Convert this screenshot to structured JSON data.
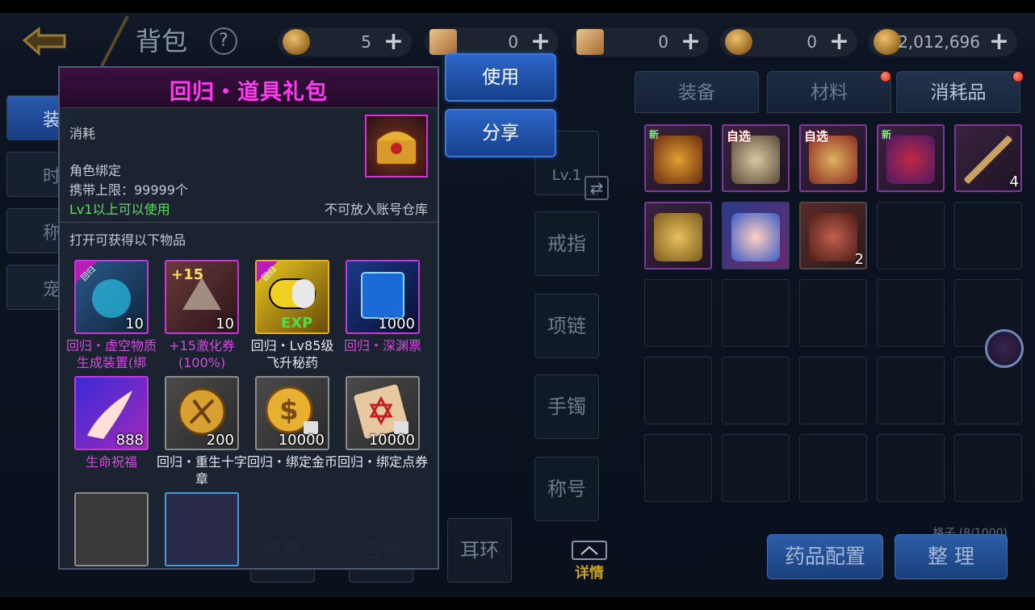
{
  "header": {
    "title": "背包",
    "help_label": "?",
    "currencies": [
      {
        "icon": "coin-icon",
        "value": "5"
      },
      {
        "icon": "scroll-icon",
        "value": "0"
      },
      {
        "icon": "locked-scroll-icon",
        "value": "0"
      },
      {
        "icon": "coin-icon",
        "value": "0"
      },
      {
        "icon": "bound-gold-icon",
        "value": "2,012,696"
      }
    ],
    "plus_label": "+"
  },
  "left_tabs": [
    "装",
    "时",
    "称",
    "宠"
  ],
  "middle": {
    "level_label": "Lv.1",
    "slots": [
      "戒指",
      "项链",
      "手镯",
      "称号"
    ],
    "bottom_slots": [
      "肩章",
      "宝物",
      "耳环"
    ],
    "detail_label": "详情"
  },
  "right": {
    "tabs": [
      "装备",
      "材料",
      "消耗品"
    ],
    "grid_count": "格子 (8/1000)",
    "items": [
      {
        "tag": "新",
        "count": ""
      },
      {
        "tag": "自选",
        "count": ""
      },
      {
        "tag": "自选",
        "count": ""
      },
      {
        "tag": "新",
        "count": ""
      },
      {
        "tag": "",
        "count": "4"
      },
      {
        "tag": "",
        "count": ""
      },
      {
        "tag": "",
        "count": ""
      },
      {
        "tag": "",
        "count": "2"
      }
    ],
    "potion_button": "药品配置",
    "sort_button": "整 理"
  },
  "popup": {
    "title": "回归・道具礼包",
    "category": "消耗",
    "bind": "角色绑定",
    "carry_limit": "携带上限：99999个",
    "level_req": "Lv1以上可以使用",
    "warehouse_note": "不可放入账号仓库",
    "contents_header": "打开可获得以下物品",
    "ribbon_text": "回归",
    "items": [
      {
        "name": "回归・虚空物质生成装置(绑",
        "count": "10",
        "frame": "purple",
        "name_color": "purple"
      },
      {
        "name": "+15激化券(100%)",
        "count": "10",
        "frame": "purple",
        "name_color": "purple"
      },
      {
        "name": "回归・Lv85级飞升秘药",
        "count": "",
        "frame": "gold",
        "name_color": "white"
      },
      {
        "name": "回归・深渊票",
        "count": "1000",
        "frame": "purple",
        "name_color": "purple"
      },
      {
        "name": "生命祝福",
        "count": "888",
        "frame": "purple",
        "name_color": "purple"
      },
      {
        "name": "回归・重生十字章",
        "count": "200",
        "frame": "grey",
        "name_color": "white"
      },
      {
        "name": "回归・绑定金币",
        "count": "10000",
        "frame": "grey",
        "name_color": "white"
      },
      {
        "name": "回归・绑定点券",
        "count": "10000",
        "frame": "grey",
        "name_color": "white"
      }
    ],
    "use_button": "使用",
    "share_button": "分享"
  },
  "colors": {
    "popup_title": "#ff3af0",
    "level_req": "#5ee05e",
    "item_name_purple": "#d44ae0",
    "button_blue": "#2d65c8"
  }
}
